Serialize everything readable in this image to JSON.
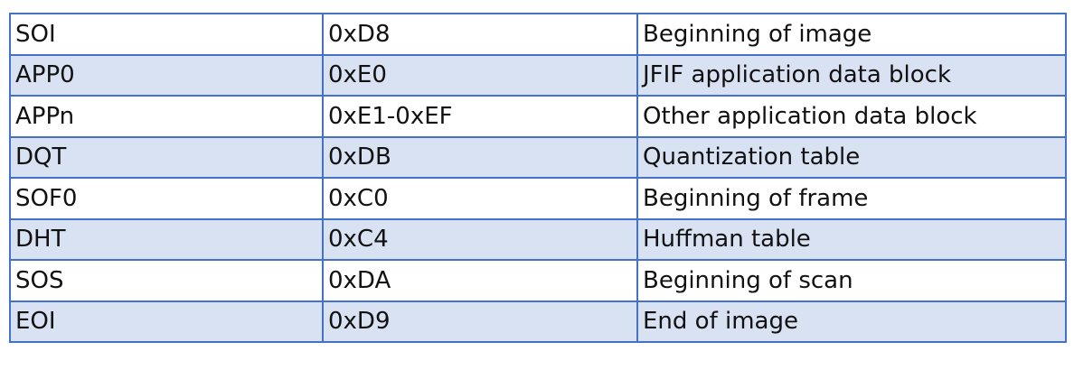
{
  "table": {
    "rows": [
      {
        "marker": "SOI",
        "code": "0xD8",
        "description": "Beginning of image"
      },
      {
        "marker": "APP0",
        "code": "0xE0",
        "description": "JFIF application data block"
      },
      {
        "marker": "APPn",
        "code": "0xE1-0xEF",
        "description": "Other application data block"
      },
      {
        "marker": "DQT",
        "code": "0xDB",
        "description": "Quantization table"
      },
      {
        "marker": "SOF0",
        "code": "0xC0",
        "description": "Beginning of frame"
      },
      {
        "marker": "DHT",
        "code": "0xC4",
        "description": "Huffman table"
      },
      {
        "marker": "SOS",
        "code": "0xDA",
        "description": "Beginning of scan"
      },
      {
        "marker": "EOI",
        "code": "0xD9",
        "description": "End of image"
      }
    ]
  },
  "colors": {
    "border": "#4472c4",
    "band": "#d9e2f3",
    "background": "#ffffff"
  }
}
